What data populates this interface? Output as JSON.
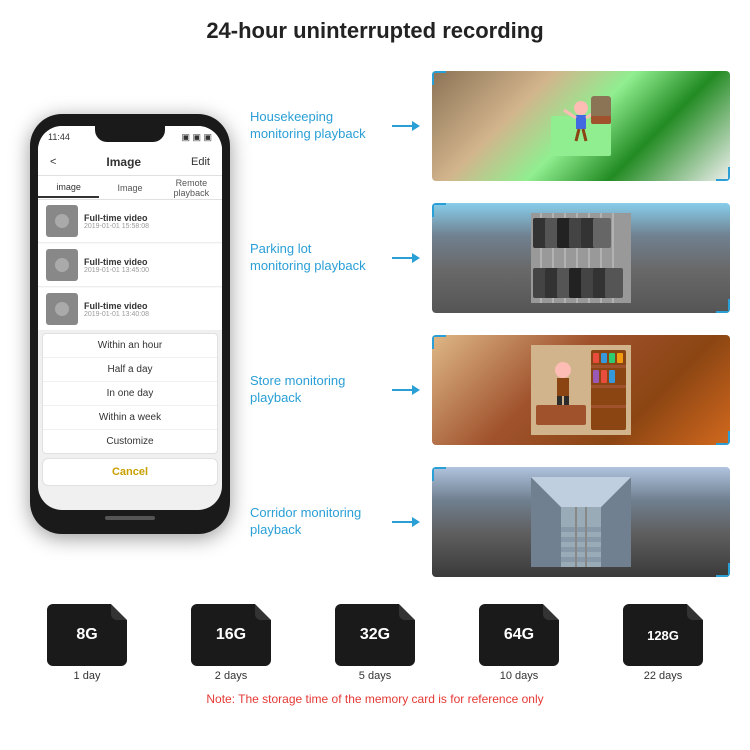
{
  "header": {
    "title": "24-hour uninterrupted recording"
  },
  "phone": {
    "status_time": "11:44",
    "nav_back": "<",
    "nav_title": "Image",
    "nav_edit": "Edit",
    "tabs": [
      "image",
      "Image",
      "Remote playback"
    ],
    "list_items": [
      {
        "title": "Full-time video",
        "date": "2019-01-01 15:58:08"
      },
      {
        "title": "Full-time video",
        "date": "2019-01-01 13:45:00"
      },
      {
        "title": "Full-time video",
        "date": "2019-01-01 13:40:08"
      }
    ],
    "dropdown_items": [
      "Within an hour",
      "Half a day",
      "In one day",
      "Within a week",
      "Customize"
    ],
    "cancel_label": "Cancel"
  },
  "monitoring": [
    {
      "label": "Housekeeping\nmonitoring playback",
      "img_class": "img-housekeeping"
    },
    {
      "label": "Parking lot\nmonitoring playback",
      "img_class": "img-parking"
    },
    {
      "label": "Store monitoring\nplayback",
      "img_class": "img-store"
    },
    {
      "label": "Corridor monitoring\nplayback",
      "img_class": "img-corridor"
    }
  ],
  "storage_cards": [
    {
      "size": "8G",
      "days": "1 day"
    },
    {
      "size": "16G",
      "days": "2 days"
    },
    {
      "size": "32G",
      "days": "5 days"
    },
    {
      "size": "64G",
      "days": "10 days"
    },
    {
      "size": "128G",
      "days": "22 days"
    }
  ],
  "storage_note": "Note: The storage time of the memory card is for reference only"
}
